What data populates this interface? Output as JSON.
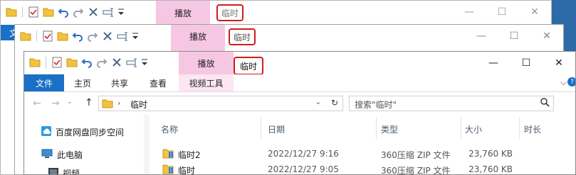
{
  "qat_icons": [
    "folder-icon",
    "properties-check-icon",
    "new-folder-icon",
    "undo-icon",
    "redo-icon",
    "delete-icon",
    "rename-icon",
    "customize-dropdown-icon"
  ],
  "window_back": {
    "context_tab": "播放",
    "context_group": "临时",
    "sidebar_stub": "文"
  },
  "window_mid": {
    "context_tab": "播放",
    "context_group": "临时",
    "tab_peek": [
      "共",
      "视频工具"
    ]
  },
  "window_front": {
    "context_tab": "播放",
    "context_group": "临时",
    "tabs": [
      "文件",
      "主页",
      "共享",
      "查看",
      "视频工具"
    ],
    "address": "临时",
    "search_placeholder": "搜索\"临时\"",
    "nav": [
      {
        "icon": "cloud-drive-icon",
        "label": "百度网盘同步空间"
      },
      {
        "icon": "computer-icon",
        "label": "此电脑"
      },
      {
        "icon": "video-folder-icon",
        "label": "视频"
      }
    ],
    "columns": [
      "名称",
      "日期",
      "类型",
      "大小",
      "时长"
    ],
    "files": [
      {
        "name": "临时2",
        "date": "2022/12/27 9:16",
        "type": "360压缩 ZIP 文件",
        "size": "23,760 KB"
      },
      {
        "name": "临时",
        "date": "2022/12/27 9:05",
        "type": "360压缩 ZIP 文件",
        "size": "23,760 KB"
      }
    ]
  }
}
